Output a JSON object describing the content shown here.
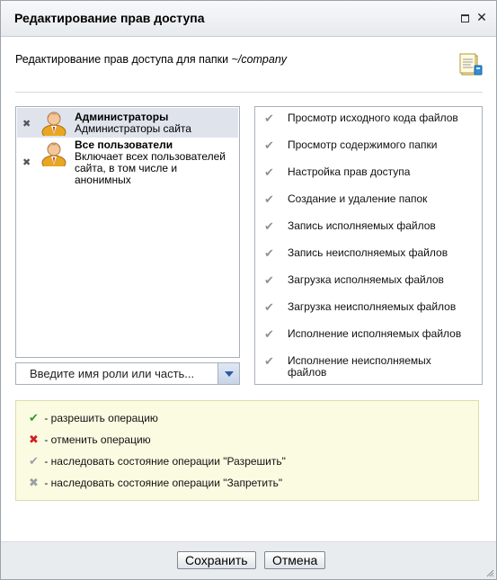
{
  "window": {
    "title": "Редактирование прав доступа",
    "maximize_icon": "maximize-icon",
    "close_icon": "close-icon"
  },
  "header": {
    "subtitle_prefix": "Редактирование прав доступа для папки",
    "folder_path": "~/company",
    "icon": "document-icon"
  },
  "roles": [
    {
      "name": "Администраторы",
      "description": "Администраторы сайта",
      "selected": true,
      "icon": "user-avatar-icon",
      "remove_icon": "remove-icon"
    },
    {
      "name": "Все пользователи",
      "description_lines": [
        "Включает всех пользователей",
        "сайта, в том числе и",
        "анонимных"
      ],
      "selected": false,
      "icon": "user-avatar-icon",
      "remove_icon": "remove-icon"
    }
  ],
  "role_combo": {
    "placeholder": "Введите имя роли или часть...",
    "dropdown_icon": "chevron-down-icon"
  },
  "operations": [
    {
      "label": "Просмотр исходного кода файлов",
      "state": "inherit-allow"
    },
    {
      "label": "Просмотр содержимого папки",
      "state": "inherit-allow"
    },
    {
      "label": "Настройка прав доступа",
      "state": "inherit-allow"
    },
    {
      "label": "Создание и удаление папок",
      "state": "inherit-allow"
    },
    {
      "label": "Запись исполняемых файлов",
      "state": "inherit-allow"
    },
    {
      "label": "Запись неисполняемых файлов",
      "state": "inherit-allow"
    },
    {
      "label": "Загрузка исполняемых файлов",
      "state": "inherit-allow"
    },
    {
      "label": "Загрузка неисполняемых файлов",
      "state": "inherit-allow"
    },
    {
      "label": "Исполнение исполняемых файлов",
      "state": "inherit-allow"
    },
    {
      "label": "Исполнение неисполняемых",
      "label_line2": "файлов",
      "state": "inherit-allow"
    }
  ],
  "legend": [
    {
      "icon": "check-icon",
      "color": "#2e9a2e",
      "text": "- разрешить операцию"
    },
    {
      "icon": "cross-icon",
      "color": "#d02020",
      "text": "- отменить операцию"
    },
    {
      "icon": "check-gray-icon",
      "color": "#9aa0a6",
      "text": "- наследовать состояние операции \"Разрешить\""
    },
    {
      "icon": "cross-gray-icon",
      "color": "#9aa0a6",
      "text": "- наследовать состояние операции \"Запретить\""
    }
  ],
  "footer": {
    "save_label": "Сохранить",
    "cancel_label": "Отмена"
  },
  "colors": {
    "allow": "#2e9a2e",
    "deny": "#d02020",
    "inherit": "#9aa0a6",
    "selection": "#dfe3ec",
    "legend_bg": "#fbfbe2"
  }
}
